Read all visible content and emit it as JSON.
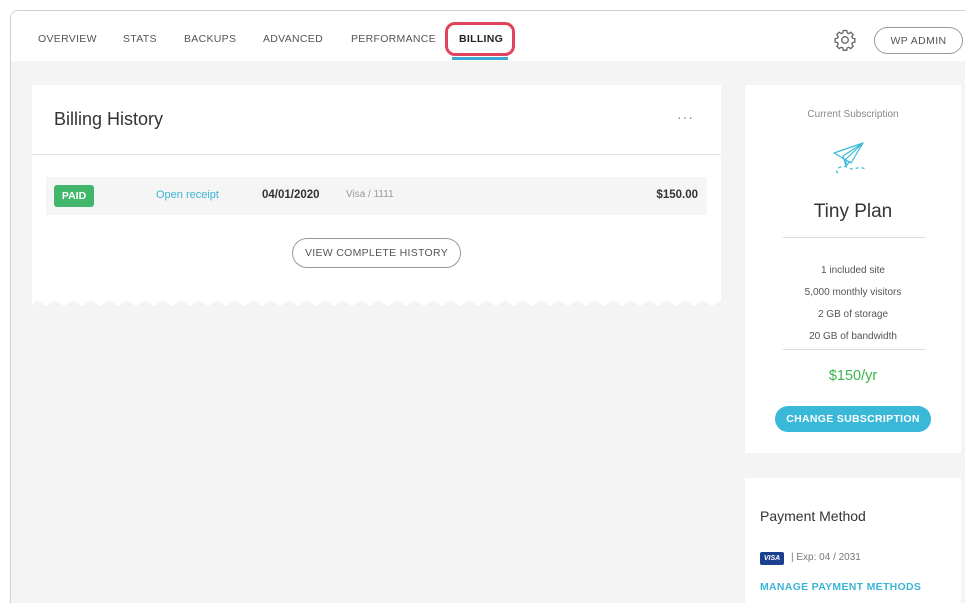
{
  "nav": {
    "tabs": [
      {
        "label": "OVERVIEW"
      },
      {
        "label": "STATS"
      },
      {
        "label": "BACKUPS"
      },
      {
        "label": "ADVANCED"
      },
      {
        "label": "PERFORMANCE"
      },
      {
        "label": "BILLING"
      }
    ],
    "active_tab": "BILLING",
    "settings_icon": "gear-icon",
    "wp_admin_label": "WP ADMIN"
  },
  "billing_history": {
    "title": "Billing History",
    "more_icon": "···",
    "rows": [
      {
        "status": "PAID",
        "receipt_link": "Open receipt",
        "date": "04/01/2020",
        "card": "Visa / 1111",
        "amount": "$150.00"
      }
    ],
    "view_complete_label": "VIEW COMPLETE HISTORY"
  },
  "subscription": {
    "label": "Current Subscription",
    "icon": "paper-plane-icon",
    "plan_name": "Tiny Plan",
    "features": [
      "1 included site",
      "5,000 monthly visitors",
      "2 GB of storage",
      "20 GB of bandwidth"
    ],
    "price": "$150/yr",
    "change_label": "CHANGE SUBSCRIPTION"
  },
  "payment_method": {
    "title": "Payment Method",
    "card_brand": "VISA",
    "expiry": "| Exp: 04 / 2031",
    "manage_label": "MANAGE PAYMENT METHODS"
  },
  "colors": {
    "accent": "#3ab8d8",
    "paid_green": "#42b76b",
    "price_green": "#3cb44b",
    "highlight": "#e2435c"
  }
}
